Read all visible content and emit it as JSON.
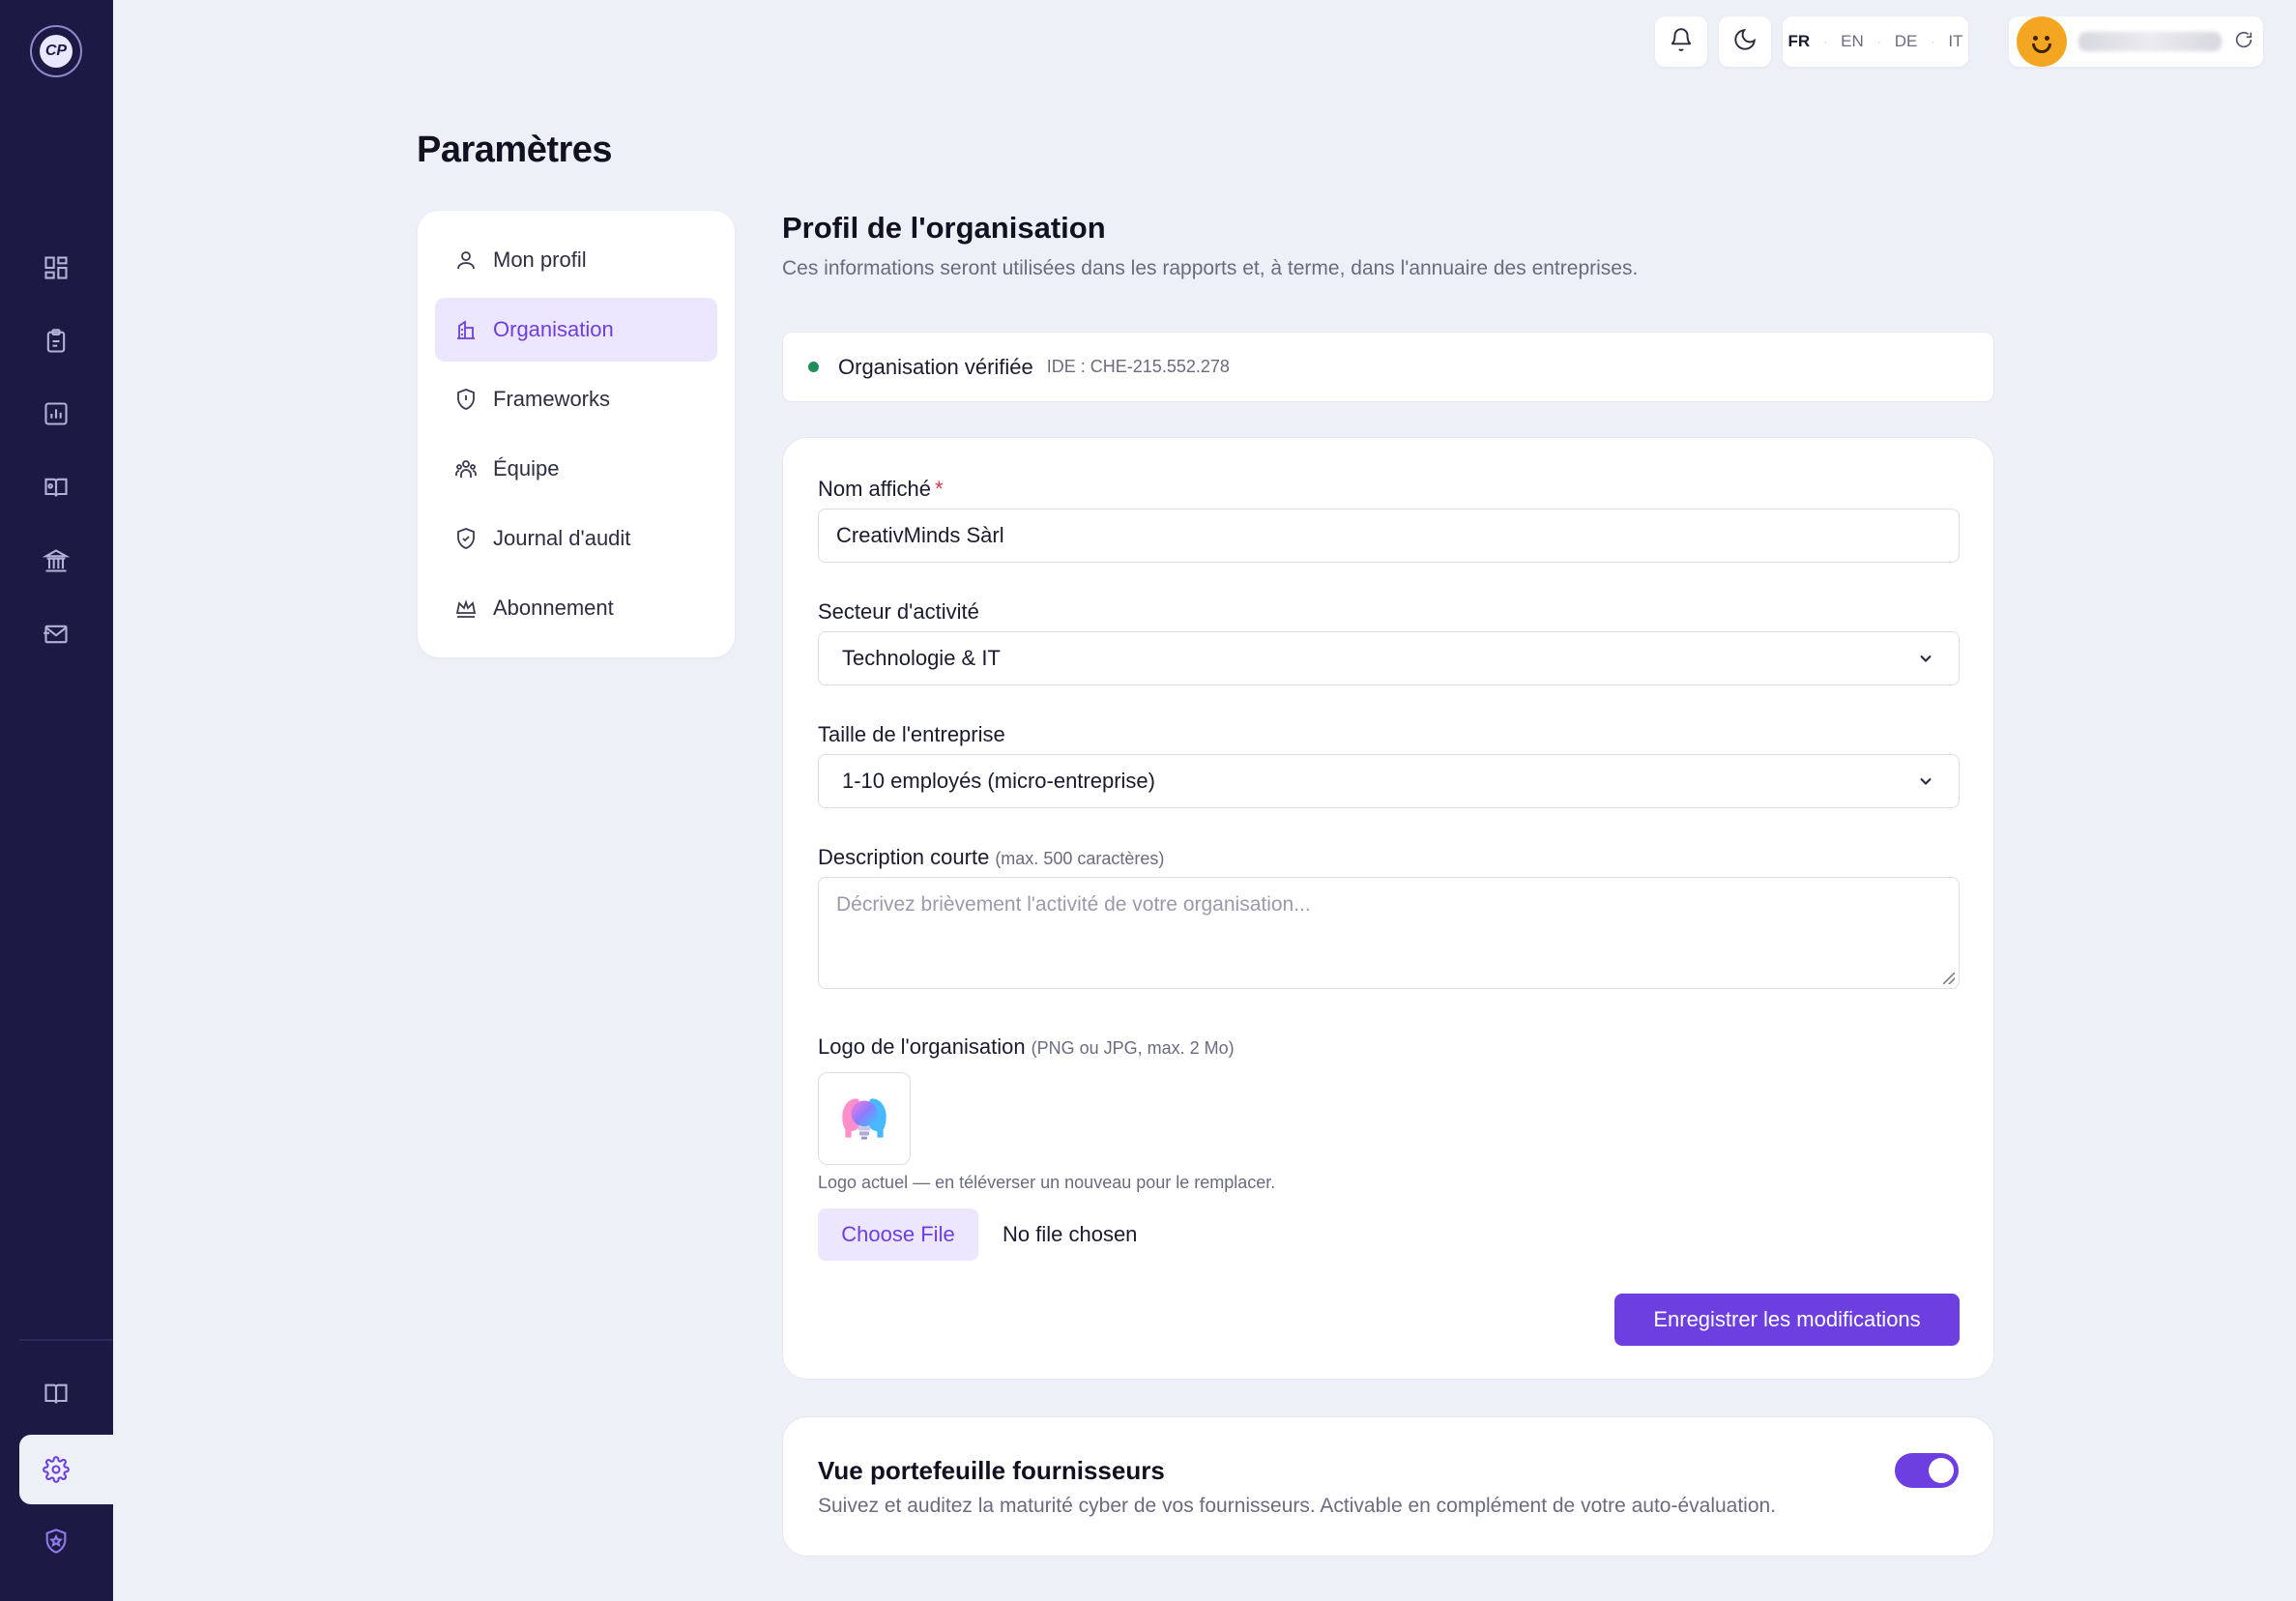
{
  "brand": {
    "logo_text": "CP",
    "accent": "#6d3fe0",
    "rail_bg": "#1c1a45"
  },
  "rail": {
    "items": [
      {
        "icon": "dashboard-icon"
      },
      {
        "icon": "clipboard-icon"
      },
      {
        "icon": "bar-chart-icon"
      },
      {
        "icon": "book-open-icon"
      },
      {
        "icon": "building-icon"
      },
      {
        "icon": "mail-send-icon"
      }
    ],
    "bottom_items": [
      {
        "icon": "book-icon"
      },
      {
        "icon": "gear-icon",
        "active": true
      },
      {
        "icon": "shield-star-icon"
      }
    ]
  },
  "topbar": {
    "languages": [
      "FR",
      "EN",
      "DE",
      "IT"
    ],
    "active_language": "FR"
  },
  "page": {
    "title": "Paramètres"
  },
  "settings_nav": {
    "items": [
      {
        "label": "Mon profil",
        "icon": "user-icon"
      },
      {
        "label": "Organisation",
        "icon": "building-icon",
        "active": true
      },
      {
        "label": "Frameworks",
        "icon": "shield-icon"
      },
      {
        "label": "Équipe",
        "icon": "team-icon"
      },
      {
        "label": "Journal d'audit",
        "icon": "shield-check-icon"
      },
      {
        "label": "Abonnement",
        "icon": "crown-icon"
      }
    ]
  },
  "org_profile": {
    "title": "Profil de l'organisation",
    "description": "Ces informations seront utilisées dans les rapports et, à terme, dans l'annuaire des entreprises.",
    "verified_label": "Organisation vérifiée",
    "verified_ide": "IDE : CHE-215.552.278",
    "display_name_label": "Nom affiché",
    "required_mark": "*",
    "display_name_value": "CreativMinds Sàrl",
    "sector_label": "Secteur d'activité",
    "sector_value": "Technologie & IT",
    "size_label": "Taille de l'entreprise",
    "size_value": "1-10 employés (micro-entreprise)",
    "short_desc_label": "Description courte",
    "short_desc_hint": "(max. 500 caractères)",
    "short_desc_placeholder": "Décrivez brièvement l'activité de votre organisation...",
    "logo_label": "Logo de l'organisation",
    "logo_hint": "(PNG ou JPG, max. 2 Mo)",
    "logo_caption": "Logo actuel — en téléverser un nouveau pour le remplacer.",
    "choose_file_label": "Choose File",
    "no_file_label": "No file chosen",
    "save_label": "Enregistrer les modifications"
  },
  "vendor_portfolio": {
    "title": "Vue portefeuille fournisseurs",
    "description": "Suivez et auditez la maturité cyber de vos fournisseurs. Activable en complément de votre auto-évaluation.",
    "enabled": true
  }
}
